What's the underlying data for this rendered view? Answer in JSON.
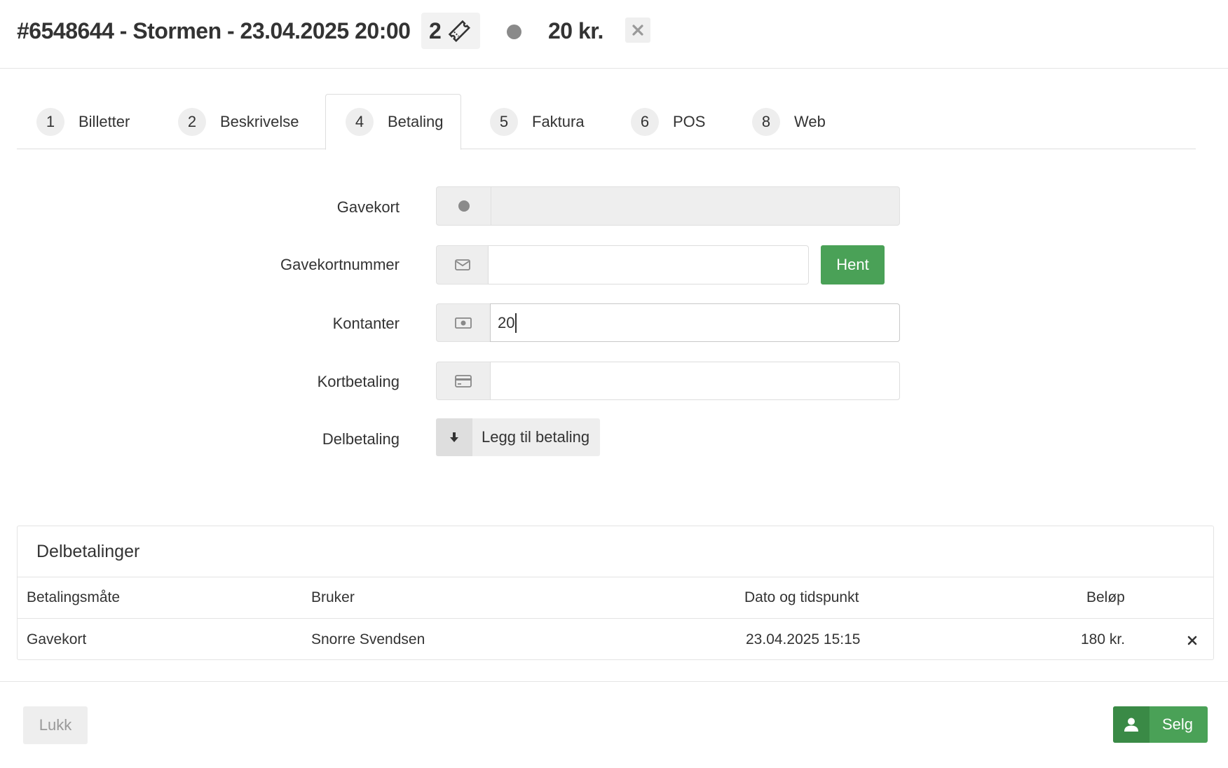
{
  "header": {
    "order_title": "#6548644 - Stormen - 23.04.2025 20:00",
    "ticket_count": "2",
    "total": "20 kr.",
    "icons": {
      "ticket": "ticket-icon",
      "status": "status-dot-icon",
      "close": "close-icon"
    }
  },
  "tabs": [
    {
      "num": "1",
      "label": "Billetter"
    },
    {
      "num": "2",
      "label": "Beskrivelse"
    },
    {
      "num": "4",
      "label": "Betaling",
      "active": true
    },
    {
      "num": "5",
      "label": "Faktura"
    },
    {
      "num": "6",
      "label": "POS"
    },
    {
      "num": "8",
      "label": "Web"
    }
  ],
  "form": {
    "gavekort": {
      "label": "Gavekort",
      "value": ""
    },
    "gavekortnummer": {
      "label": "Gavekortnummer",
      "value": "",
      "button": "Hent"
    },
    "kontanter": {
      "label": "Kontanter",
      "value": "20"
    },
    "kortbetaling": {
      "label": "Kortbetaling",
      "value": ""
    },
    "delbetaling": {
      "label": "Delbetaling",
      "button": "Legg til betaling"
    }
  },
  "panel": {
    "title": "Delbetalinger",
    "columns": [
      "Betalingsmåte",
      "Bruker",
      "Dato og tidspunkt",
      "Beløp"
    ],
    "rows": [
      {
        "method": "Gavekort",
        "user": "Snorre Svendsen",
        "datetime": "23.04.2025 15:15",
        "amount": "180 kr."
      }
    ]
  },
  "footer": {
    "close_label": "Lukk",
    "sell_label": "Selg"
  },
  "colors": {
    "primary_green": "#4aa157",
    "dark_green": "#3a8a46",
    "addon_gray": "#eeeeee"
  }
}
